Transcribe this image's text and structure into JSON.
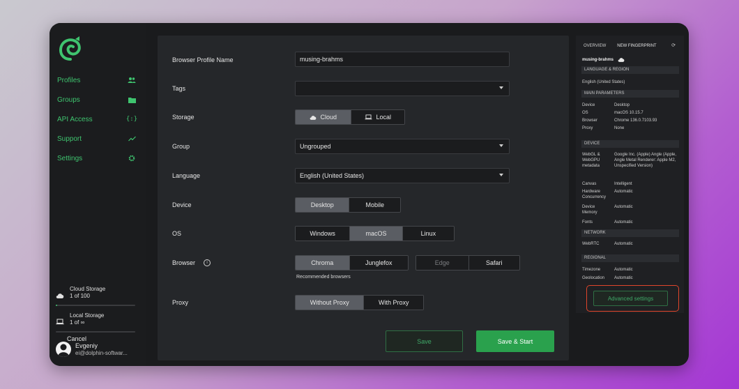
{
  "sidebar": {
    "nav": [
      {
        "label": "Profiles",
        "icon": "users-icon"
      },
      {
        "label": "Groups",
        "icon": "folder-icon"
      },
      {
        "label": "API Access",
        "icon": "braces-icon"
      },
      {
        "label": "Support",
        "icon": "trend-icon"
      },
      {
        "label": "Settings",
        "icon": "gear-icon"
      }
    ],
    "cloud_storage": {
      "title": "Cloud Storage",
      "value": "1 of 100",
      "fill_fraction": 0.01
    },
    "local_storage": {
      "title": "Local Storage",
      "value": "1 of ∞"
    },
    "user": {
      "name": "Evgeniy",
      "email": "ei@dolphin-softwar..."
    }
  },
  "form": {
    "profile_name": {
      "label": "Browser Profile Name",
      "value": "musing-brahms"
    },
    "tags": {
      "label": "Tags",
      "value": ""
    },
    "storage": {
      "label": "Storage",
      "options": [
        "Cloud",
        "Local"
      ],
      "selected": "Cloud"
    },
    "group": {
      "label": "Group",
      "value": "Ungrouped"
    },
    "language": {
      "label": "Language",
      "value": "English (United States)"
    },
    "device": {
      "label": "Device",
      "options": [
        "Desktop",
        "Mobile"
      ],
      "selected": "Desktop"
    },
    "os": {
      "label": "OS",
      "options": [
        "Windows",
        "macOS",
        "Linux"
      ],
      "selected": "macOS"
    },
    "browser": {
      "label": "Browser",
      "options": [
        "Chroma",
        "Junglefox"
      ],
      "other_options": [
        "Edge",
        "Safari"
      ],
      "selected": "Chroma",
      "hint": "Recommended browsers"
    },
    "proxy": {
      "label": "Proxy",
      "options": [
        "Without Proxy",
        "With Proxy"
      ],
      "selected": "Without Proxy"
    },
    "cancel_label": "Cancel",
    "save_label": "Save",
    "save_start_label": "Save & Start"
  },
  "overview": {
    "tab_overview": "OVERVIEW",
    "tab_new_fingerprint": "NEW FINGERPRINT",
    "profile_name": "musing-brahms",
    "sections": {
      "language_region": "LANGUAGE & REGION",
      "main_parameters": "MAIN PARAMETERS",
      "device": "DEVICE",
      "network": "NETWORK",
      "regional": "REGIONAL"
    },
    "language_value": "English (United States)",
    "main": {
      "device_k": "Device",
      "device_v": "Desktop",
      "os_k": "OS",
      "os_v": "macOS 10.15.7",
      "browser_k": "Browser",
      "browser_v": "Chrome 136.0.7103.93",
      "proxy_k": "Proxy",
      "proxy_v": "None"
    },
    "device": {
      "webgl_k": "WebGL & WebGPU metadata",
      "webgl_v": "Google Inc. (Apple) Angle (Apple, Angle Metal Renderer: Apple M2, Unspecified Version)",
      "canvas_k": "Canvas",
      "canvas_v": "Intelligent",
      "hw_k": "Hardware Concurrency",
      "hw_v": "Automatic",
      "mem_k": "Device Memory",
      "mem_v": "Automatic",
      "fonts_k": "Fonts",
      "fonts_v": "Automatic"
    },
    "network": {
      "webrtc_k": "WebRTC",
      "webrtc_v": "Automatic"
    },
    "regional": {
      "tz_k": "Timezone",
      "tz_v": "Automatic",
      "geo_k": "Geolocation",
      "geo_v": "Automatic"
    },
    "advanced_label": "Advanced settings"
  },
  "colors": {
    "accent": "#3fc46f",
    "primary_button": "#2aa14d",
    "highlight_border": "#e0452b"
  }
}
